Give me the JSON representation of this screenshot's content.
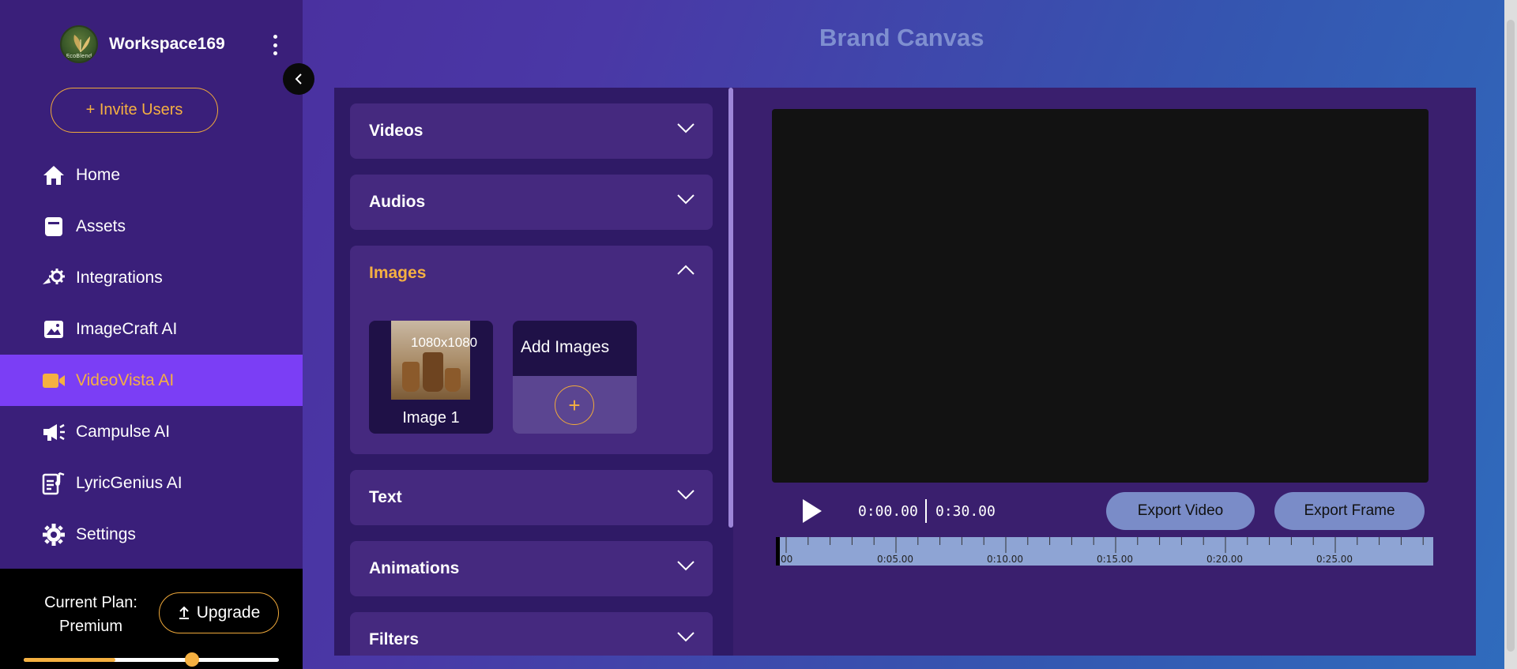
{
  "workspace": {
    "name": "Workspace169",
    "logo_text": "EcoBlend"
  },
  "sidebar": {
    "invite_label": "+ Invite Users",
    "items": [
      {
        "label": "Home",
        "icon": "home-icon"
      },
      {
        "label": "Assets",
        "icon": "assets-icon"
      },
      {
        "label": "Integrations",
        "icon": "integrations-icon"
      },
      {
        "label": "ImageCraft AI",
        "icon": "image-icon"
      },
      {
        "label": "VideoVista AI",
        "icon": "video-camera-icon",
        "active": true
      },
      {
        "label": "Campulse AI",
        "icon": "megaphone-icon"
      },
      {
        "label": "LyricGenius AI",
        "icon": "lyric-icon"
      },
      {
        "label": "Settings",
        "icon": "gear-icon"
      }
    ],
    "plan": {
      "line1": "Current Plan:",
      "line2": "Premium",
      "upgrade_label": "Upgrade",
      "usage_fraction": 0.36,
      "thumb_fraction": 0.66
    }
  },
  "page": {
    "title": "Brand Canvas"
  },
  "panel": {
    "sections": [
      {
        "label": "Videos",
        "open": false
      },
      {
        "label": "Audios",
        "open": false
      },
      {
        "label": "Images",
        "open": true
      },
      {
        "label": "Text",
        "open": false
      },
      {
        "label": "Animations",
        "open": false
      },
      {
        "label": "Filters",
        "open": false
      }
    ],
    "images": [
      {
        "name": "Image 1",
        "resolution": "1080x1080"
      }
    ],
    "add_images_label": "Add Images",
    "add_icon": "+"
  },
  "player": {
    "current_time": "0:00.00",
    "total_time": "0:30.00",
    "export_video_label": "Export Video",
    "export_frame_label": "Export Frame",
    "timeline_labels": [
      "00",
      "0:05.00",
      "0:10.00",
      "0:15.00",
      "0:20.00",
      "0:25.00"
    ]
  },
  "colors": {
    "accent": "#f5b041",
    "active_nav": "#7b3ef5",
    "sidebar": "#3a1f7a",
    "panel": "#2f1a66"
  }
}
